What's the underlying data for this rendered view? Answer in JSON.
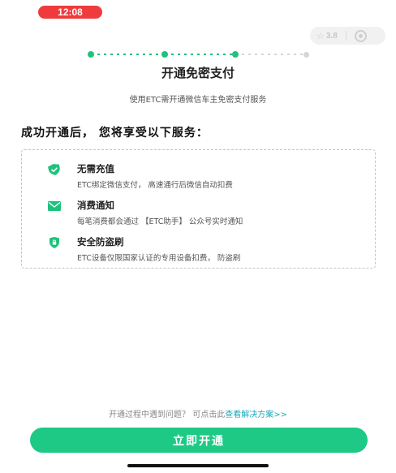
{
  "status_bar": {
    "time": "12:08"
  },
  "capsule": {
    "star_icon": "star-icon",
    "rating": "3.8",
    "target_icon": "target-icon"
  },
  "steps": {
    "current": 3,
    "total": 4,
    "accent": "#1fc27c"
  },
  "page": {
    "title": "开通免密支付",
    "subtitle": "使用ETC需开通微信车主免密支付服务",
    "section_heading": "成功开通后， 您将享受以下服务："
  },
  "benefits": [
    {
      "icon": "shield-check-icon",
      "title": "无需充值",
      "desc": "ETC绑定微信支付， 高速通行后微信自动扣费"
    },
    {
      "icon": "mail-icon",
      "title": "消费通知",
      "desc": "每笔消费都会通过 【ETC助手】 公众号实时通知"
    },
    {
      "icon": "shield-lock-icon",
      "title": "安全防盗刷",
      "desc": "ETC设备仅限国家认证的专用设备扣费， 防盗刷"
    }
  ],
  "help": {
    "text": "开通过程中遇到问题？ 可点击此",
    "link": "查看解决方案>>"
  },
  "cta": {
    "label": "立即开通",
    "color": "#1ec986"
  }
}
